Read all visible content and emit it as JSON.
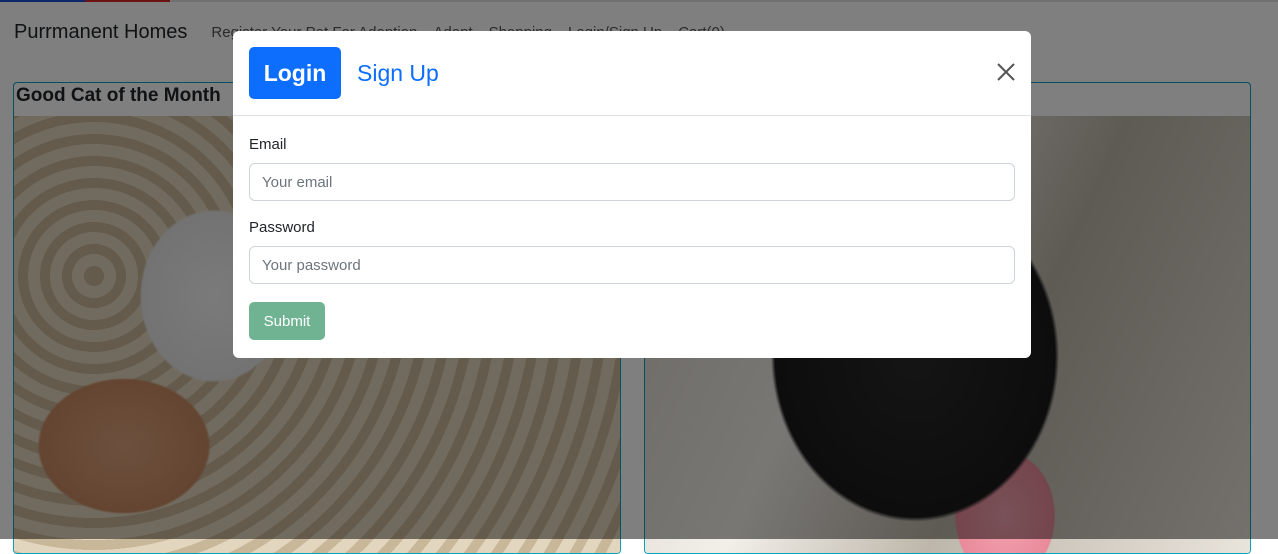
{
  "navbar": {
    "brand": "Purrmanent Homes",
    "links": [
      "Register Your Pet For Adoption",
      "Adopt",
      "Shopping",
      "Login/Sign Up",
      "Cart(0)"
    ]
  },
  "cards": {
    "left_title": "Good Cat of the Month"
  },
  "modal": {
    "login_tab": "Login",
    "signup_tab": "Sign Up",
    "close_icon": "close-icon",
    "email": {
      "label": "Email",
      "placeholder": "Your email",
      "value": ""
    },
    "password": {
      "label": "Password",
      "placeholder": "Your password",
      "value": ""
    },
    "submit_label": "Submit"
  },
  "colors": {
    "primary": "#0d6efd",
    "submit": "#6fb393",
    "card_border": "#0aa2c0",
    "backdrop": "rgba(0,0,0,0.5)"
  }
}
